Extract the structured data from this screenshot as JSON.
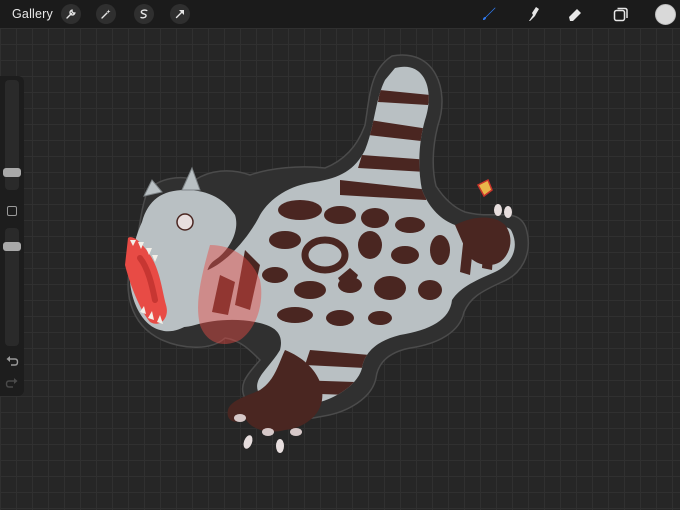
{
  "topbar": {
    "gallery_label": "Gallery",
    "left_tools": [
      "wrench-icon",
      "magic-wand-icon",
      "selection-icon",
      "transform-arrow-icon"
    ],
    "right_tools": [
      "brush-icon",
      "smudge-icon",
      "eraser-icon",
      "layers-icon"
    ],
    "active_tool": "brush-icon",
    "accent_color": "#2f7cf6",
    "current_color": "#d9d9d9"
  },
  "sidebar": {
    "brush_size_level": 0.26,
    "opacity_level": 0.29,
    "tools": [
      "modify-square-icon",
      "undo-icon",
      "redo-icon"
    ]
  },
  "canvas": {
    "background": "#262626",
    "grid": true,
    "artwork": "dinosaur-sticker"
  }
}
